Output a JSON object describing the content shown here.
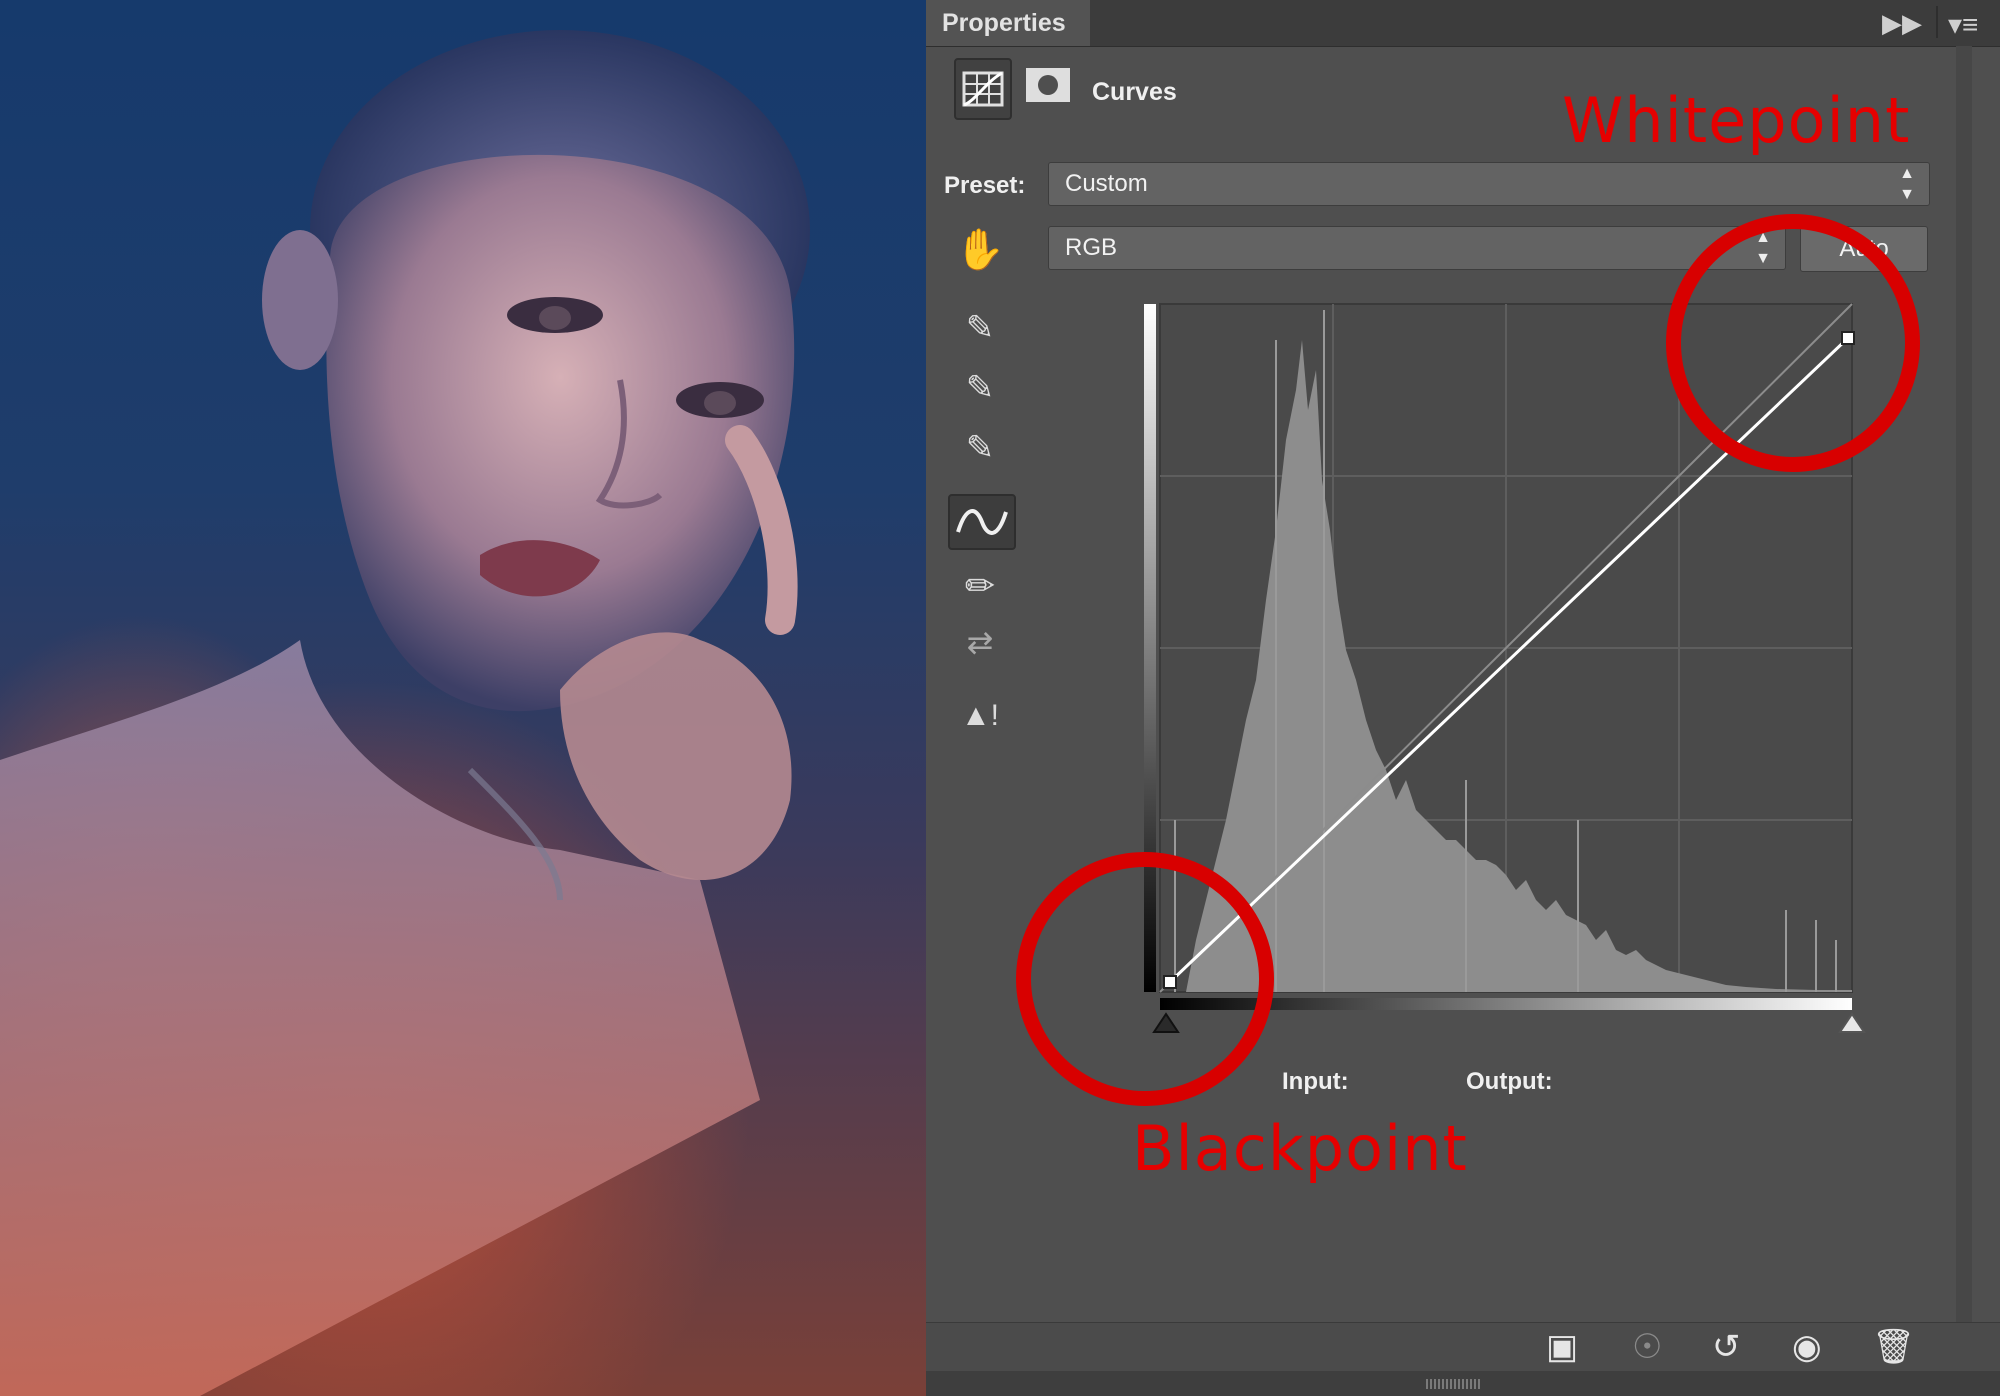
{
  "panel": {
    "tab_title": "Properties",
    "adjustment_title": "Curves",
    "preset_label": "Preset:",
    "preset_value": "Custom",
    "channel_value": "RGB",
    "auto_label": "Auto",
    "input_label": "Input:",
    "output_label": "Output:"
  },
  "annotations": {
    "whitepoint": "Whitepoint",
    "blackpoint": "Blackpoint",
    "color": "#e00000"
  },
  "icons": {
    "tabbar": [
      "collapse-panel-icon",
      "panel-menu-icon"
    ],
    "modes": [
      "curves-adjustment-icon",
      "layer-mask-icon"
    ],
    "tools": [
      "on-image-adjust-icon",
      "black-eyedropper-icon",
      "gray-eyedropper-icon",
      "white-eyedropper-icon",
      "curve-points-icon",
      "pencil-draw-icon",
      "smooth-curve-icon",
      "clipping-warning-icon"
    ],
    "footer": [
      "clip-to-layer-icon",
      "view-previous-state-icon",
      "reset-adjustment-icon",
      "toggle-visibility-icon",
      "delete-adjustment-icon"
    ]
  }
}
